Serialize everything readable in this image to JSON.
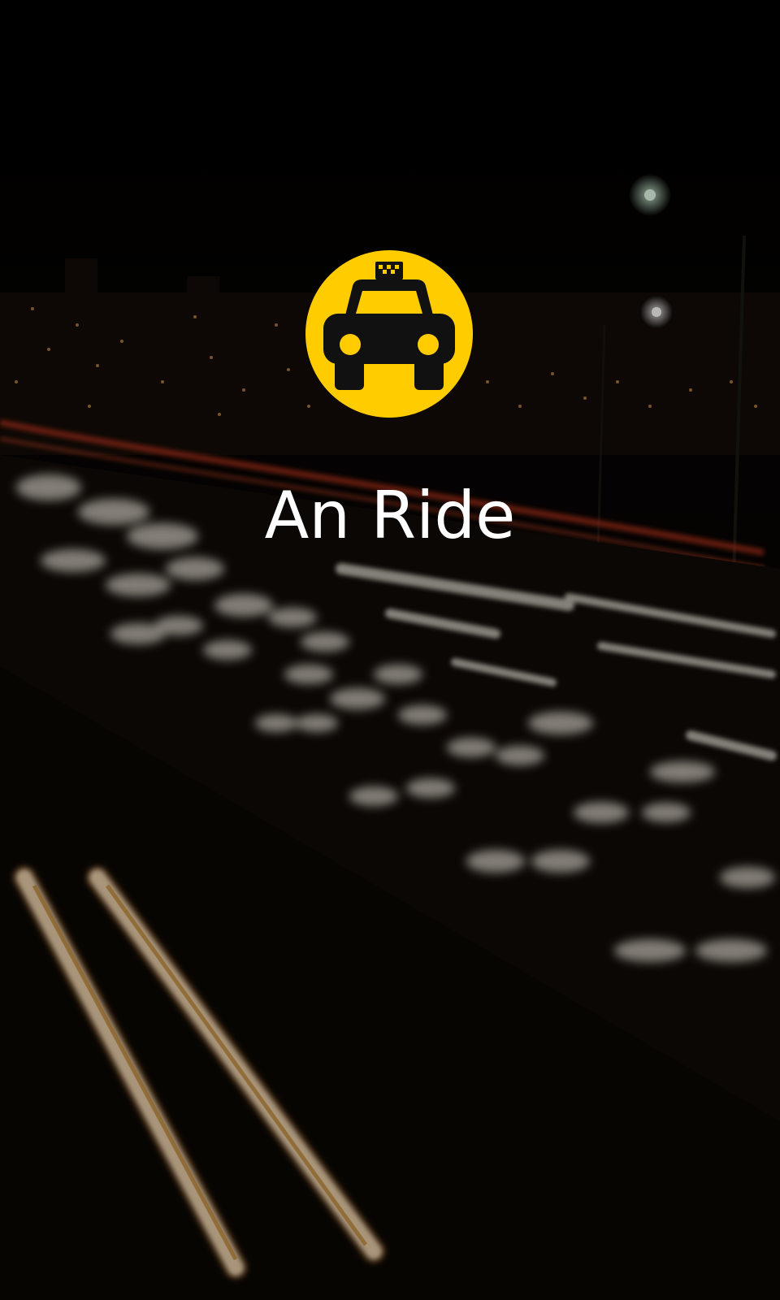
{
  "app": {
    "name": "An Ride",
    "logo_icon": "taxi-icon",
    "accent_color": "#FFCC00"
  },
  "background": {
    "description_icon": "night-traffic-background"
  }
}
